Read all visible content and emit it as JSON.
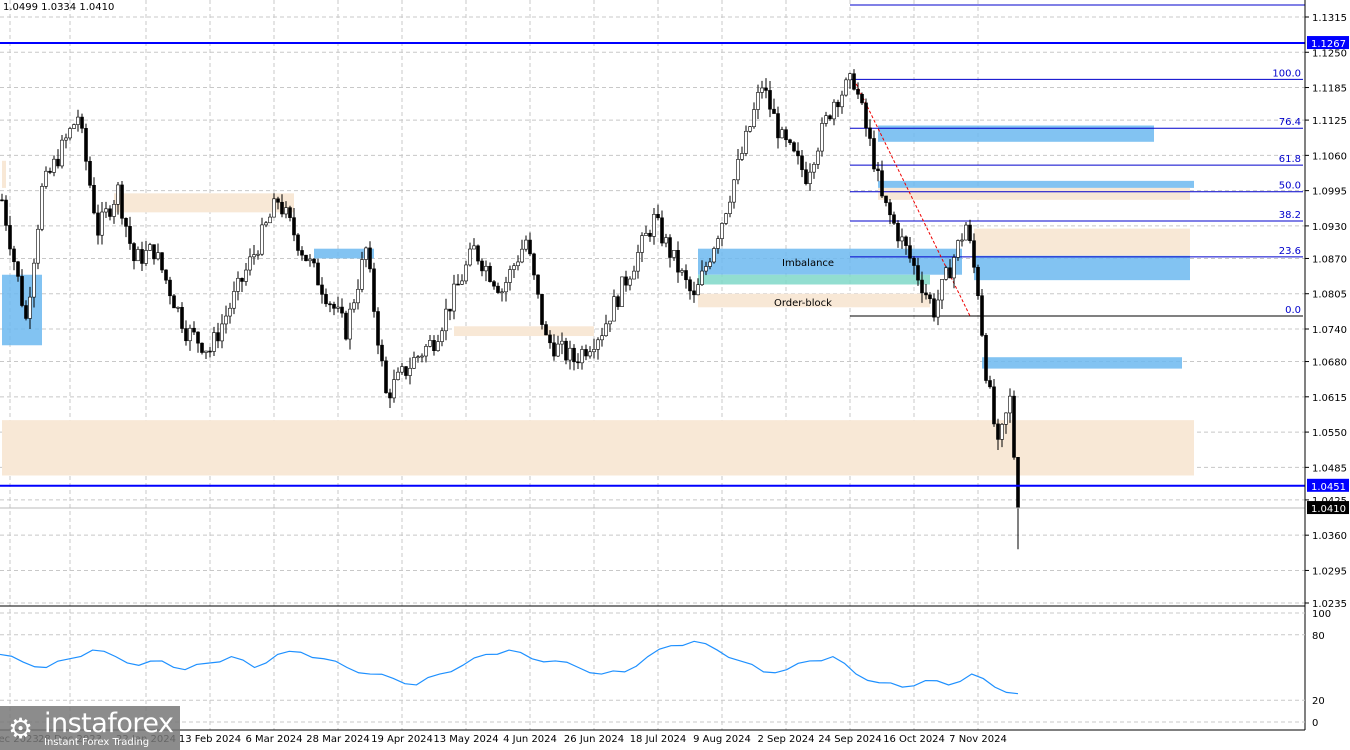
{
  "header": {
    "ohlc": "1.0499 1.0334 1.0410"
  },
  "logo": {
    "name": "instaforex",
    "tagline": "Instant Forex Trading"
  },
  "chart_data": {
    "type": "candlestick",
    "symbol_values": {
      "high": 1.0499,
      "low": 1.0334,
      "close": 1.041
    },
    "y_ticks": [
      "1.1315",
      "1.1250",
      "1.1185",
      "1.1125",
      "1.1060",
      "1.0995",
      "1.0930",
      "1.0870",
      "1.0805",
      "1.0740",
      "1.0680",
      "1.0615",
      "1.0550",
      "1.0485",
      "1.0425",
      "1.0360",
      "1.0295",
      "1.0235"
    ],
    "ylim": [
      1.0235,
      1.1315
    ],
    "x_labels": [
      {
        "i": 2,
        "t": "9 Dec 2023"
      },
      {
        "i": 17,
        "t": "28 Dec 2023"
      },
      {
        "i": 36,
        "t": "22 Jan 2024"
      },
      {
        "i": 52,
        "t": "13 Feb 2024"
      },
      {
        "i": 68,
        "t": "6 Mar 2024"
      },
      {
        "i": 84,
        "t": "28 Mar 2024"
      },
      {
        "i": 100,
        "t": "19 Apr 2024"
      },
      {
        "i": 116,
        "t": "13 May 2024"
      },
      {
        "i": 132,
        "t": "4 Jun 2024"
      },
      {
        "i": 148,
        "t": "26 Jun 2024"
      },
      {
        "i": 164,
        "t": "18 Jul 2024"
      },
      {
        "i": 180,
        "t": "9 Aug 2024"
      },
      {
        "i": 196,
        "t": "2 Sep 2024"
      },
      {
        "i": 212,
        "t": "24 Sep 2024"
      },
      {
        "i": 228,
        "t": "16 Oct 2024"
      },
      {
        "i": 244,
        "t": "7 Nov 2024"
      }
    ],
    "path": [
      [
        0,
        1.0978
      ],
      [
        6,
        1.0757
      ],
      [
        10,
        1.0996
      ],
      [
        19,
        1.1134
      ],
      [
        24,
        1.0922
      ],
      [
        29,
        1.0996
      ],
      [
        33,
        1.0867
      ],
      [
        38,
        1.0886
      ],
      [
        46,
        1.0738
      ],
      [
        52,
        1.0701
      ],
      [
        60,
        1.083
      ],
      [
        69,
        1.0978
      ],
      [
        75,
        1.0886
      ],
      [
        86,
        1.0738
      ],
      [
        91,
        1.0886
      ],
      [
        96,
        1.0618
      ],
      [
        103,
        1.0683
      ],
      [
        108,
        1.072
      ],
      [
        118,
        1.0886
      ],
      [
        125,
        1.0812
      ],
      [
        131,
        1.0904
      ],
      [
        136,
        1.072
      ],
      [
        143,
        1.0683
      ],
      [
        150,
        1.0738
      ],
      [
        163,
        1.0941
      ],
      [
        173,
        1.0793
      ],
      [
        180,
        1.0941
      ],
      [
        186,
        1.1088
      ],
      [
        190,
        1.119
      ],
      [
        195,
        1.1088
      ],
      [
        201,
        1.1024
      ],
      [
        208,
        1.1162
      ],
      [
        213,
        1.1199
      ],
      [
        218,
        1.1051
      ],
      [
        220,
        1.0978
      ],
      [
        226,
        1.0886
      ],
      [
        233,
        1.0775
      ],
      [
        241,
        1.0932
      ],
      [
        244,
        1.0812
      ],
      [
        246,
        1.0664
      ],
      [
        249,
        1.0517
      ],
      [
        252,
        1.0609
      ],
      [
        254,
        1.041
      ]
    ],
    "horizontal_lines": [
      {
        "price": 1.1267,
        "label": "1.1267"
      },
      {
        "price": 1.0451,
        "label": "1.0451"
      }
    ],
    "current_price": "1.0410",
    "fibonacci": {
      "from_index": 212,
      "levels": [
        {
          "l": "100.0",
          "p": 1.12
        },
        {
          "l": "76.4",
          "p": 1.111
        },
        {
          "l": "61.8",
          "p": 1.1042
        },
        {
          "l": "50.0",
          "p": 1.0993
        },
        {
          "l": "38.2",
          "p": 1.0939
        },
        {
          "l": "23.6",
          "p": 1.0873
        },
        {
          "l": "0.0",
          "p": 1.0764
        }
      ]
    },
    "zones": [
      {
        "kind": "supply",
        "i0": 0,
        "i1": 298,
        "p0": 1.047,
        "p1": 1.0572
      },
      {
        "kind": "supply",
        "i0": 243,
        "i1": 297,
        "p0": 1.0875,
        "p1": 1.0925
      },
      {
        "kind": "demand",
        "i0": 243,
        "i1": 297,
        "p0": 1.083,
        "p1": 1.0875
      },
      {
        "kind": "demand",
        "i0": 219,
        "i1": 288,
        "p0": 1.1085,
        "p1": 1.1115
      },
      {
        "kind": "demand",
        "i0": 219,
        "i1": 298,
        "p0": 1.1,
        "p1": 1.1013
      },
      {
        "kind": "supply",
        "i0": 219,
        "i1": 297,
        "p0": 1.0978,
        "p1": 1.1
      },
      {
        "kind": "demand",
        "i0": 245,
        "i1": 295,
        "p0": 1.0667,
        "p1": 1.0688
      },
      {
        "kind": "demand",
        "i0": 174,
        "i1": 240,
        "p0": 1.084,
        "p1": 1.0888
      },
      {
        "kind": "green",
        "i0": 174,
        "i1": 232,
        "p0": 1.0822,
        "p1": 1.084
      },
      {
        "kind": "supply",
        "i0": 174,
        "i1": 232,
        "p0": 1.078,
        "p1": 1.0805
      },
      {
        "kind": "supply",
        "i0": 28,
        "i1": 73,
        "p0": 1.0955,
        "p1": 1.099
      },
      {
        "kind": "demand",
        "i0": 78,
        "i1": 93,
        "p0": 1.087,
        "p1": 1.0888
      },
      {
        "kind": "supply",
        "i0": 113,
        "i1": 148,
        "p0": 1.0727,
        "p1": 1.0745
      },
      {
        "kind": "demand",
        "i0": 0,
        "i1": 10,
        "p0": 1.071,
        "p1": 1.084
      },
      {
        "kind": "supply",
        "i0": 0,
        "i1": 1,
        "p0": 1.1,
        "p1": 1.105
      }
    ],
    "zone_labels": [
      {
        "text": "Imbalance",
        "i": 195,
        "p": 1.0865
      },
      {
        "text": "Order-block",
        "i": 193,
        "p": 1.0792
      }
    ],
    "oscillator": {
      "ylim": [
        0,
        100
      ],
      "ticks": [
        "100",
        "80",
        "20",
        "0"
      ],
      "values": [
        62,
        55,
        50,
        58,
        66,
        60,
        52,
        56,
        48,
        54,
        60,
        50,
        62,
        64,
        58,
        50,
        44,
        40,
        34,
        44,
        52,
        62,
        66,
        58,
        56,
        50,
        44,
        46,
        60,
        70,
        74,
        66,
        56,
        46,
        48,
        56,
        60,
        44,
        36,
        32,
        38,
        34,
        44,
        32,
        26
      ]
    }
  },
  "colors": {
    "supply": "#f8e8d6",
    "demand": "#6cb8f0",
    "green": "#7fd8c8",
    "line": "#0000ff",
    "candle": "#000000",
    "osc": "#1e90ff"
  }
}
